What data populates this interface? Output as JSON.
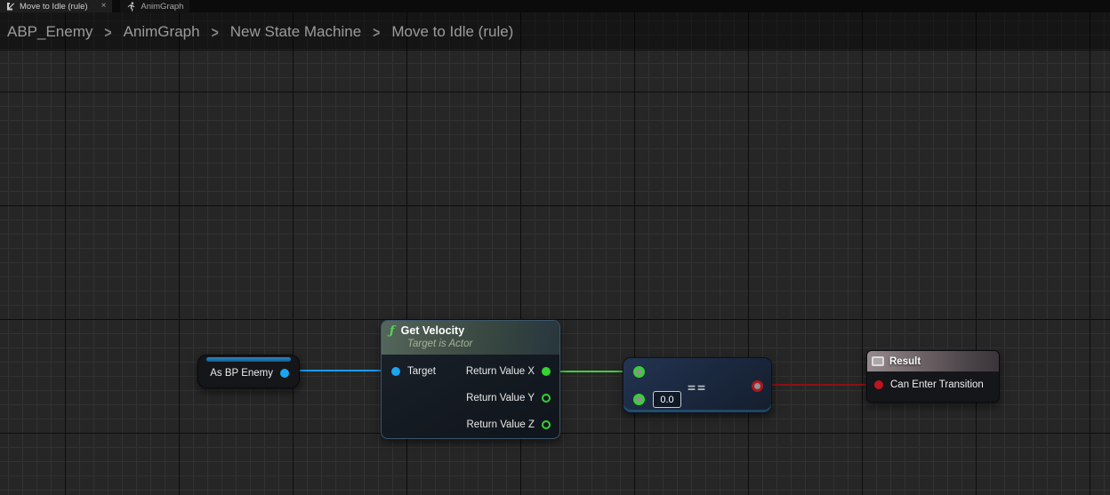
{
  "tabs": [
    {
      "label": "Move to Idle (rule)",
      "close_glyph": "×",
      "icon": "transition-rule",
      "active": true
    },
    {
      "label": "AnimGraph",
      "icon": "running-person",
      "active": false
    }
  ],
  "breadcrumb": {
    "separator": ">",
    "items": [
      "ABP_Enemy",
      "AnimGraph",
      "New State Machine",
      "Move to Idle (rule)"
    ]
  },
  "graph": {
    "nodes": {
      "as_bp_enemy": {
        "label": "As BP Enemy"
      },
      "get_velocity": {
        "fn_glyph": "ƒ",
        "title": "Get Velocity",
        "subtitle": "Target is Actor",
        "input_pin": "Target",
        "output_pins": [
          "Return Value X",
          "Return Value Y",
          "Return Value Z"
        ]
      },
      "equals": {
        "operator": "==",
        "default_value": "0.0"
      },
      "result": {
        "title": "Result",
        "input_pin": "Can Enter Transition"
      }
    }
  },
  "colors": {
    "grid_bg": "#262626",
    "object_pin": "#1aa5ef",
    "float_pin": "#35d235",
    "bool_pin": "#c0141f",
    "object_wire": "#1e9ae8",
    "float_wire": "#3ecf3e",
    "bool_wire": "#8c1118"
  }
}
